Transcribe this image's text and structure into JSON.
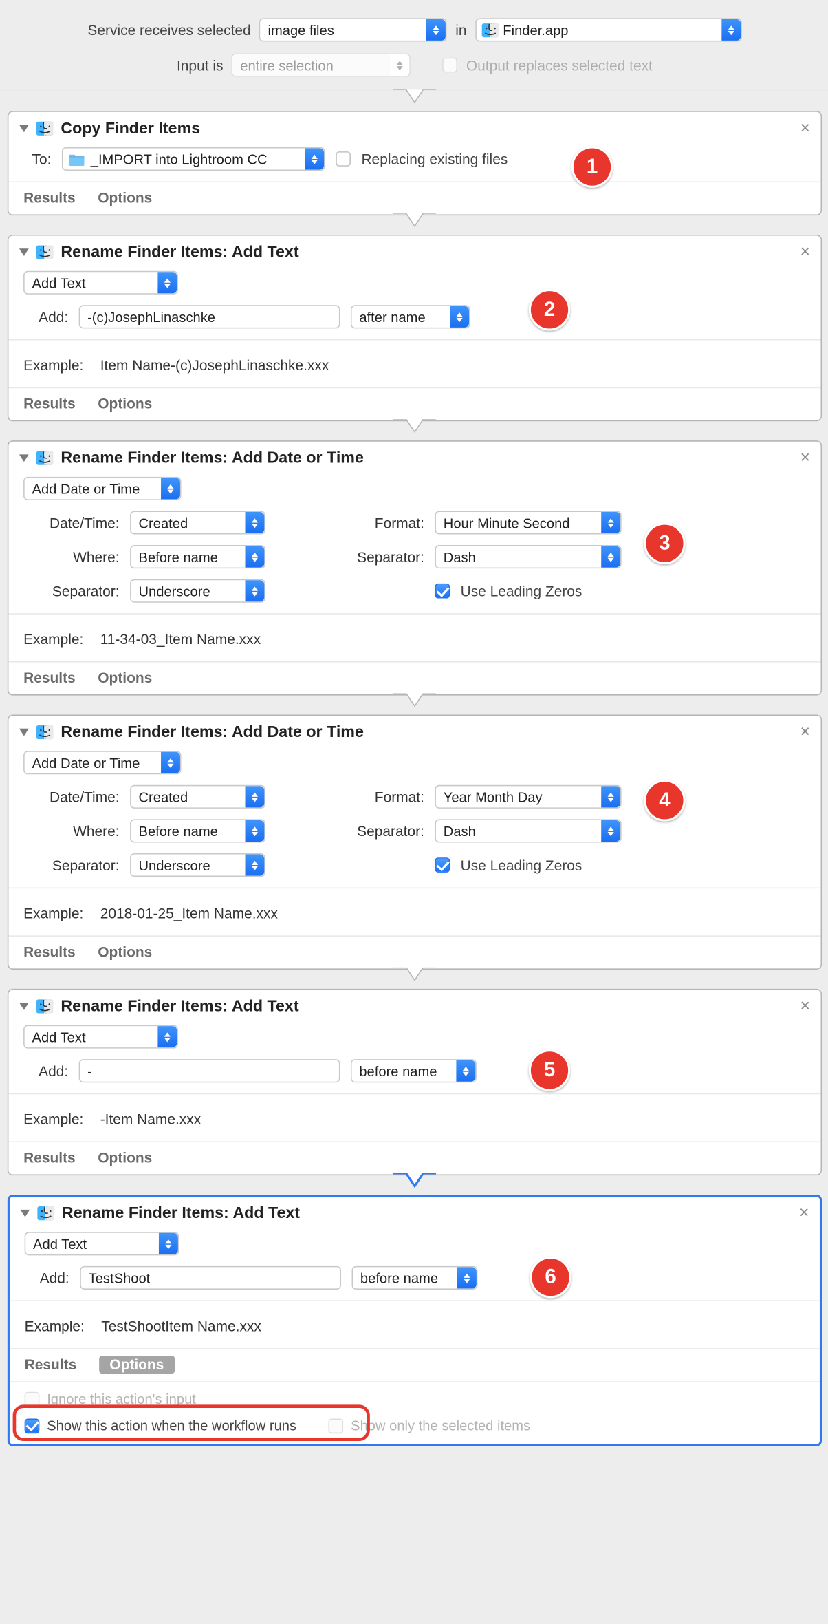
{
  "top": {
    "service_label": "Service receives selected",
    "service_value": "image files",
    "in_label": "in",
    "app_value": "Finder.app",
    "input_label": "Input is",
    "input_value": "entire selection",
    "output_replaces": "Output replaces selected text"
  },
  "common": {
    "to": "To:",
    "add": "Add:",
    "example": "Example:",
    "results": "Results",
    "options": "Options",
    "datetime": "Date/Time:",
    "where": "Where:",
    "separator": "Separator:",
    "format": "Format:",
    "leading": "Use Leading Zeros"
  },
  "a1": {
    "title": "Copy Finder Items",
    "folder": "_IMPORT into Lightroom CC",
    "replace": "Replacing existing files",
    "badge": "1"
  },
  "a2": {
    "title": "Rename Finder Items: Add Text",
    "op": "Add Text",
    "value": "-(c)JosephLinaschke",
    "pos": "after name",
    "example": "Item Name-(c)JosephLinaschke.xxx",
    "badge": "2"
  },
  "a3": {
    "title": "Rename Finder Items: Add Date or Time",
    "op": "Add Date or Time",
    "datetime": "Created",
    "where": "Before name",
    "sep1": "Underscore",
    "format": "Hour Minute Second",
    "sep2": "Dash",
    "example": "11-34-03_Item Name.xxx",
    "badge": "3"
  },
  "a4": {
    "title": "Rename Finder Items: Add Date or Time",
    "op": "Add Date or Time",
    "datetime": "Created",
    "where": "Before name",
    "sep1": "Underscore",
    "format": "Year Month Day",
    "sep2": "Dash",
    "example": "2018-01-25_Item Name.xxx",
    "badge": "4"
  },
  "a5": {
    "title": "Rename Finder Items: Add Text",
    "op": "Add Text",
    "value": "-",
    "pos": "before name",
    "example": "-Item Name.xxx",
    "badge": "5"
  },
  "a6": {
    "title": "Rename Finder Items: Add Text",
    "op": "Add Text",
    "value": "TestShoot",
    "pos": "before name",
    "example": "TestShootItem Name.xxx",
    "badge": "6",
    "opt_ignore": "Ignore this action's input",
    "opt_show": "Show this action when the workflow runs",
    "opt_only": "Show only the selected items"
  }
}
